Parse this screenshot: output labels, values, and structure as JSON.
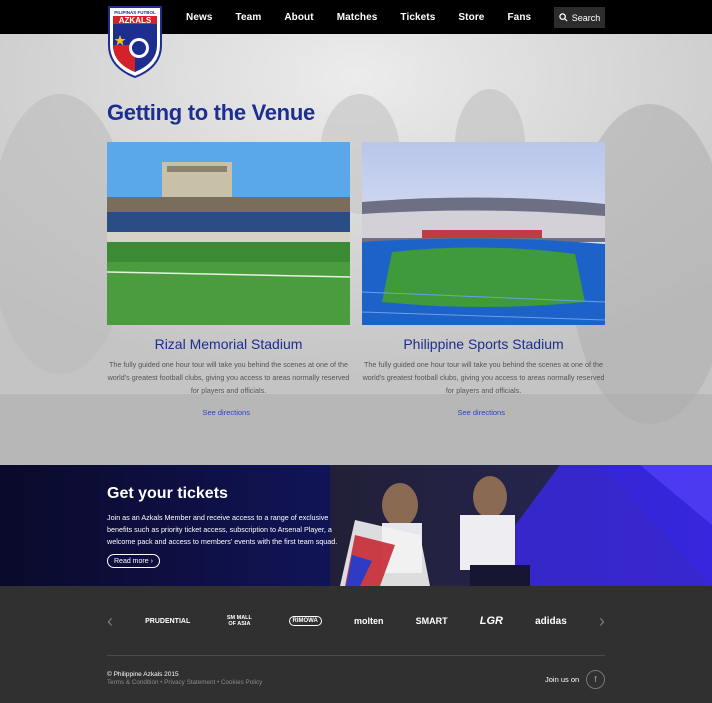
{
  "brand": {
    "logo_top_text": "PILIPINAS FUTBOL",
    "logo_name": "AZKALS"
  },
  "nav": {
    "items": [
      "News",
      "Team",
      "About",
      "Matches",
      "Tickets",
      "Store",
      "Fans"
    ],
    "search_label": "Search"
  },
  "venue": {
    "title": "Getting to the Venue",
    "cards": [
      {
        "title": "Rizal Memorial Stadium",
        "text": "The fully guided one hour tour will take you behind the scenes at one of the world's greatest football clubs, giving you access to areas normally reserved for players and officials.",
        "link": "See directions"
      },
      {
        "title": "Philippine Sports Stadium",
        "text": "The fully guided one hour tour will take you behind the scenes at one of the world's greatest football clubs, giving you access to areas normally reserved for players and officials.",
        "link": "See directions"
      }
    ]
  },
  "tickets": {
    "title": "Get your tickets",
    "text": "Join as an Azkals Member and receive access to a range of exclusive benefits such as priority ticket access, subscription to Arsenal Player, a welcome pack and access to members' events with the first team squad.",
    "read_more": "Read more"
  },
  "sponsors": {
    "items": [
      "PRUDENTIAL",
      "SM MALL OF ASIA",
      "RIMOWA",
      "molten",
      "SMART",
      "LGR",
      "adidas"
    ],
    "prev_icon": "chevron-left-icon",
    "next_icon": "chevron-right-icon"
  },
  "footer": {
    "copyright": "© Philippine Azkals 2015",
    "links": [
      "Terms & Condition",
      "Privacy Statement",
      "Cookies Policy"
    ],
    "join_label": "Join us on",
    "social_icon": "facebook-icon"
  },
  "colors": {
    "accent_blue": "#1c2e8f",
    "link_blue": "#2b43c8",
    "header_bg": "#000000",
    "footer_bg": "#303030"
  }
}
